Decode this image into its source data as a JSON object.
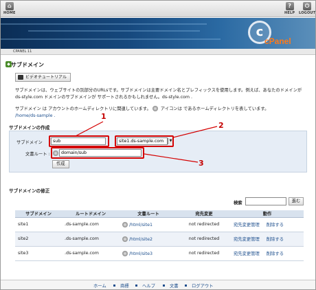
{
  "toolbar": {
    "home_label": "HOME",
    "help_label": "HELP",
    "logout_label": "LOGOUT"
  },
  "brand": {
    "logo_text": "cPanel",
    "breadcrumb": "CPANEL 11"
  },
  "page": {
    "title": "サブドメイン",
    "video_button": "ビデオチュートリアル",
    "description1": "サブドメインは、ウェブサイトの別部分のURLsです。サブドメインは主要ドメイン名とプレフィックスを使用します。例えば、あなたのドメインが ds-style.com ドメインのサブドメインが サポートされるかもしれません。ds-style.com .",
    "description2_a": "サブドメイン は アカウントのホームディレクトリに関連しています。",
    "description2_b": "アイコンは であるホームディレクトリを表しています。",
    "home_dir_link": "/home/ds-sample ."
  },
  "create": {
    "section_title": "サブドメインの作成",
    "subdomain_label": "サブドメイン",
    "subdomain_value": "sub",
    "domain_value": "site1.ds-sample.com",
    "docroot_label": "文書ルート :",
    "docroot_value": "domain/sub",
    "create_button": "作成"
  },
  "callouts": [
    "1",
    "2",
    "3"
  ],
  "modify": {
    "section_title": "サブドメインの修正",
    "search_label": "検索",
    "search_button": "進む",
    "headers": [
      "サブドメイン",
      "ルートドメイン",
      "文書ルート",
      "宛先変更",
      "動作"
    ],
    "rows": [
      {
        "sub": "site1",
        "root": ".ds-sample.com",
        "doc": "/html/site1",
        "redir": "not redirected",
        "act1": "宛先変更管理",
        "act2": "削除する"
      },
      {
        "sub": "site2",
        "root": ".ds-sample.com",
        "doc": "/html/site2",
        "redir": "not redirected",
        "act1": "宛先変更管理",
        "act2": "削除する"
      },
      {
        "sub": "site3",
        "root": ".ds-sample.com",
        "doc": "/html/site3",
        "redir": "not redirected",
        "act1": "宛先変更管理",
        "act2": "削除する"
      }
    ]
  },
  "footer": [
    "ホーム",
    "商標",
    "ヘルプ",
    "文書",
    "ログアウト"
  ],
  "colors": {
    "accent": "#1b4d8c",
    "highlight": "#d40000",
    "logo": "#ff7a1a"
  }
}
